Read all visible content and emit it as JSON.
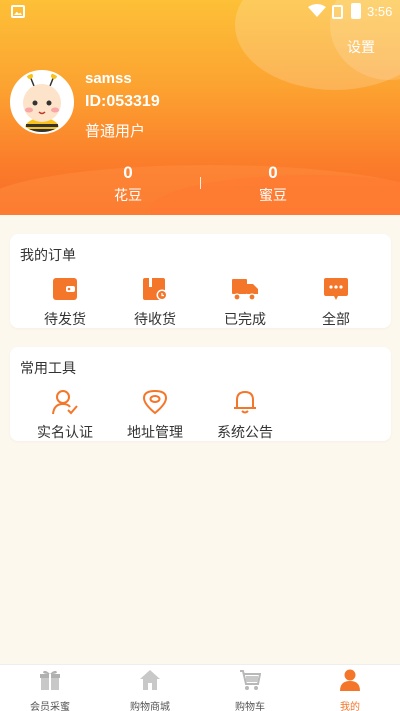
{
  "status_bar": {
    "time": "3:56"
  },
  "header": {
    "settings_label": "设置",
    "username": "samss",
    "user_id": "ID:053319",
    "user_type": "普通用户",
    "stats": [
      {
        "value": "0",
        "label": "花豆"
      },
      {
        "value": "0",
        "label": "蜜豆"
      }
    ]
  },
  "orders": {
    "title": "我的订单",
    "items": [
      {
        "label": "待发货",
        "icon": "wallet-icon"
      },
      {
        "label": "待收货",
        "icon": "package-icon"
      },
      {
        "label": "已完成",
        "icon": "truck-icon"
      },
      {
        "label": "全部",
        "icon": "chat-bubble-icon"
      }
    ]
  },
  "tools": {
    "title": "常用工具",
    "items": [
      {
        "label": "实名认证",
        "icon": "user-verify-icon"
      },
      {
        "label": "地址管理",
        "icon": "location-pin-icon"
      },
      {
        "label": "系统公告",
        "icon": "bell-icon"
      }
    ]
  },
  "bottom_nav": {
    "items": [
      {
        "label": "会员采蜜",
        "icon": "gift-icon"
      },
      {
        "label": "购物商城",
        "icon": "home-icon"
      },
      {
        "label": "购物车",
        "icon": "cart-icon"
      },
      {
        "label": "我的",
        "icon": "person-icon",
        "active": true
      }
    ]
  },
  "colors": {
    "accent": "#f4762a",
    "header_top": "#fdc037",
    "header_bottom": "#f86a27"
  }
}
